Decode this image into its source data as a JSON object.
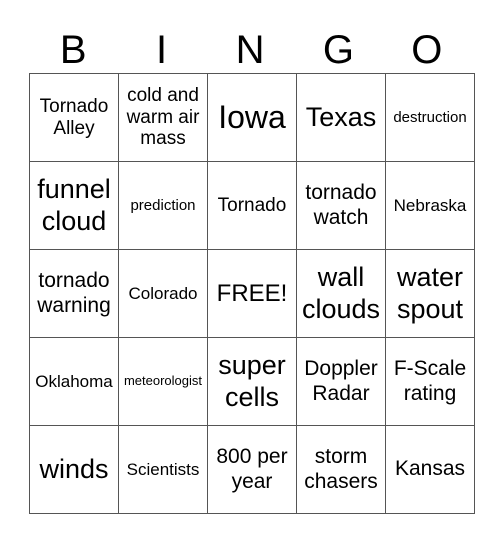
{
  "header": [
    "B",
    "I",
    "N",
    "G",
    "O"
  ],
  "rows": [
    [
      "Tornado Alley",
      "cold and warm air mass",
      "Iowa",
      "Texas",
      "destruction"
    ],
    [
      "funnel cloud",
      "prediction",
      "Tornado",
      "tornado watch",
      "Nebraska"
    ],
    [
      "tornado warning",
      "Colorado",
      "FREE!",
      "wall clouds",
      "water spout"
    ],
    [
      "Oklahoma",
      "meteorologist",
      "super cells",
      "Doppler Radar",
      "F-Scale rating"
    ],
    [
      "winds",
      "Scientists",
      "800 per year",
      "storm chasers",
      "Kansas"
    ]
  ]
}
